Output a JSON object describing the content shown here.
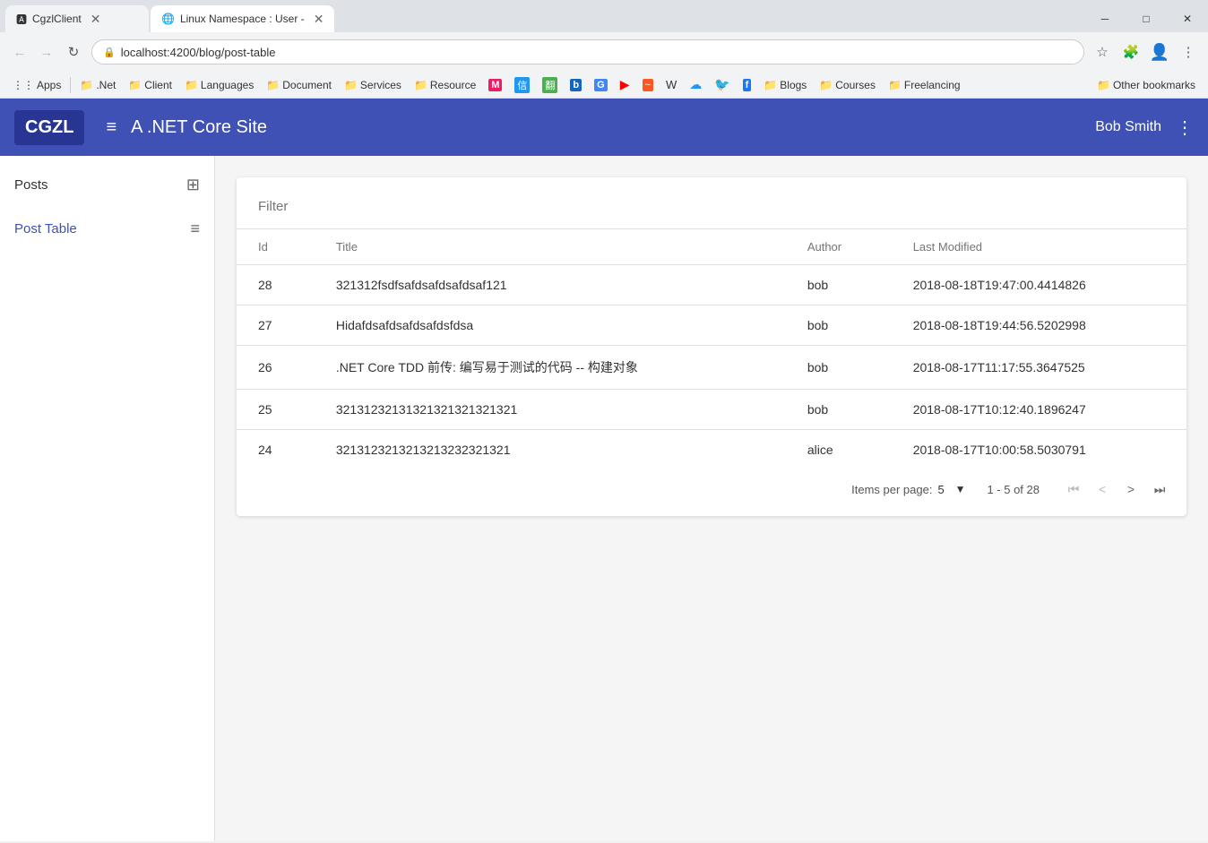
{
  "browser": {
    "tabs": [
      {
        "id": "tab1",
        "label": "CgzlClient",
        "active": false,
        "favicon": "🅰"
      },
      {
        "id": "tab2",
        "label": "Linux Namespace : User -",
        "active": true,
        "favicon": "🐧"
      }
    ],
    "address": "localhost:4200/blog/post-table",
    "window_controls": {
      "minimize": "─",
      "maximize": "□",
      "close": "✕"
    }
  },
  "bookmarks": [
    {
      "label": "Apps",
      "icon": "⋮⋮"
    },
    {
      "label": ".Net",
      "icon": "📁"
    },
    {
      "label": "Client",
      "icon": "📁"
    },
    {
      "label": "Languages",
      "icon": "📁"
    },
    {
      "label": "Document",
      "icon": "📁"
    },
    {
      "label": "Services",
      "icon": "📁"
    },
    {
      "label": "Resource",
      "icon": "📁"
    },
    {
      "label": "M",
      "icon": "M"
    },
    {
      "label": "信",
      "icon": "信"
    },
    {
      "label": "翻",
      "icon": "翻"
    },
    {
      "label": "b",
      "icon": "b"
    },
    {
      "label": "G",
      "icon": "G"
    },
    {
      "label": "▶",
      "icon": "▶"
    },
    {
      "label": "~",
      "icon": "~"
    },
    {
      "label": "W",
      "icon": "W"
    },
    {
      "label": "☁",
      "icon": "☁"
    },
    {
      "label": "🐦",
      "icon": "🐦"
    },
    {
      "label": "f",
      "icon": "f"
    },
    {
      "label": "Blogs",
      "icon": "📁"
    },
    {
      "label": "Courses",
      "icon": "📁"
    },
    {
      "label": "Freelancing",
      "icon": "📁"
    },
    {
      "label": "Other bookmarks",
      "icon": "📁"
    }
  ],
  "app": {
    "logo": "CGZL",
    "title": "A .NET Core Site",
    "user": "Bob Smith",
    "menu_icon": "≡",
    "dots_icon": "⋮"
  },
  "sidebar": {
    "items": [
      {
        "label": "Posts",
        "icon": "⊞",
        "active": false
      },
      {
        "label": "Post Table",
        "icon": "≡",
        "active": true
      }
    ]
  },
  "table": {
    "filter_placeholder": "Filter",
    "columns": [
      {
        "key": "id",
        "label": "Id"
      },
      {
        "key": "title",
        "label": "Title"
      },
      {
        "key": "author",
        "label": "Author"
      },
      {
        "key": "last_modified",
        "label": "Last Modified"
      }
    ],
    "rows": [
      {
        "id": "28",
        "title": "321312fsdfsafdsafdsafdsaf121",
        "author": "bob",
        "last_modified": "2018-08-18T19:47:00.4414826"
      },
      {
        "id": "27",
        "title": "Hidafdsafdsafdsafdsfdsa",
        "author": "bob",
        "last_modified": "2018-08-18T19:44:56.5202998"
      },
      {
        "id": "26",
        "title": ".NET Core TDD 前传: 编写易于测试的代码 -- 构建对象",
        "author": "bob",
        "last_modified": "2018-08-17T11:17:55.3647525"
      },
      {
        "id": "25",
        "title": "32131232131321321321321321",
        "author": "bob",
        "last_modified": "2018-08-17T10:12:40.1896247"
      },
      {
        "id": "24",
        "title": "3213123213213213232321321",
        "author": "alice",
        "last_modified": "2018-08-17T10:00:58.5030791"
      }
    ],
    "footer": {
      "items_per_page_label": "Items per page:",
      "items_per_page_value": "5",
      "page_info": "1 - 5 of 28"
    }
  }
}
